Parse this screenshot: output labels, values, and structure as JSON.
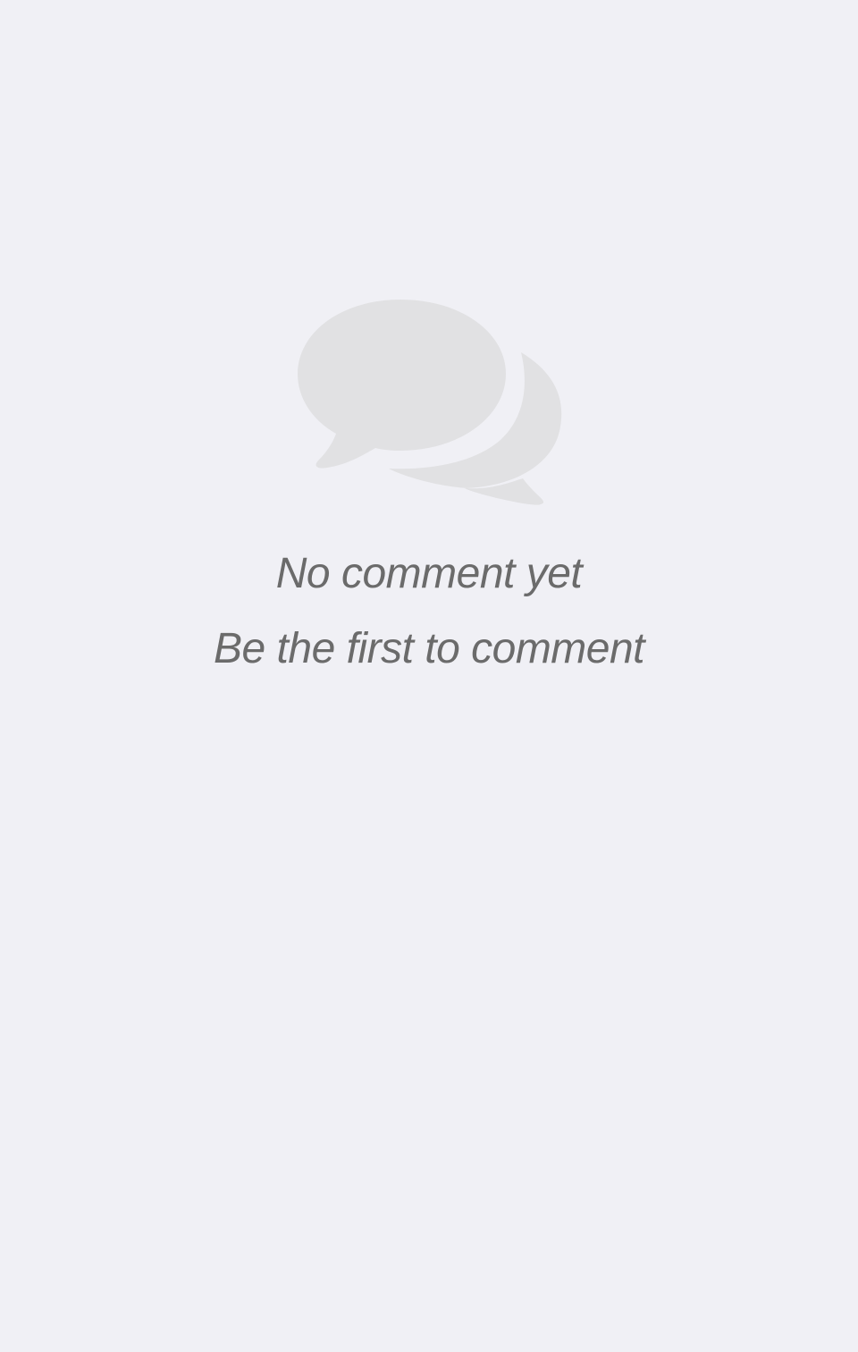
{
  "empty_state": {
    "icon": "chat-bubbles-icon",
    "icon_color": "#e1e1e3",
    "title": "No comment yet",
    "subtitle": "Be the first to comment"
  },
  "colors": {
    "background": "#f0f0f5",
    "text": "#6b6b6b"
  }
}
